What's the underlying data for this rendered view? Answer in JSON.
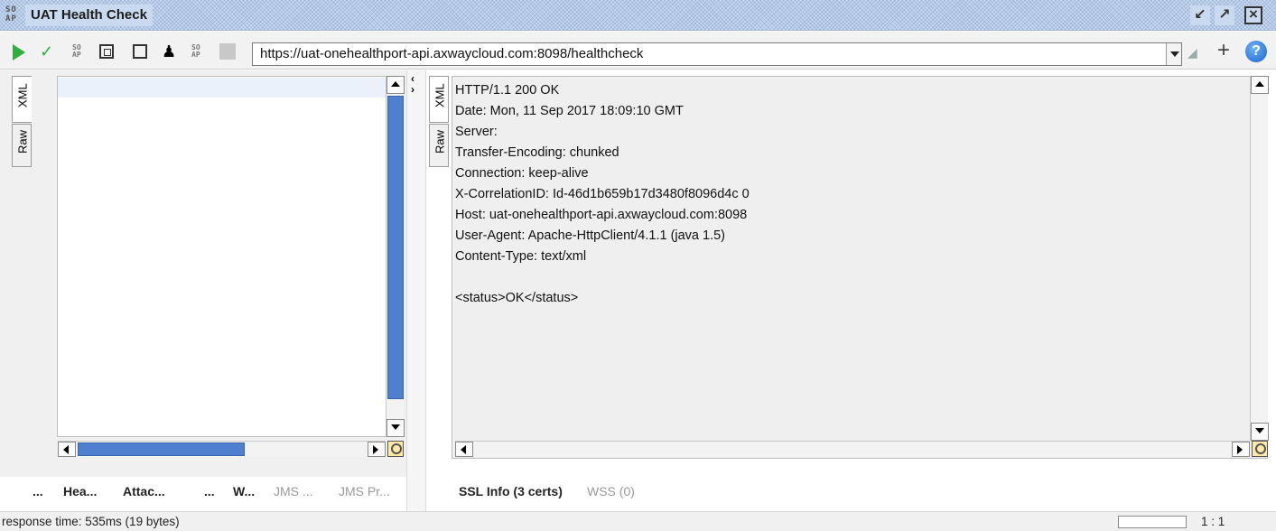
{
  "window": {
    "title": "UAT Health Check",
    "title_icon": "SO\nAP"
  },
  "toolbar": {
    "url": "https://uat-onehealthport-api.axwaycloud.com:8098/healthcheck",
    "plus_glyph": "+",
    "help_glyph": "?"
  },
  "request_panel": {
    "vertical_tabs": [
      "XML",
      "Raw"
    ],
    "bottom_tabs": [
      "...",
      "Hea...",
      "Attac...",
      "...",
      "W...",
      "JMS ...",
      "JMS Pr..."
    ]
  },
  "response_panel": {
    "vertical_tabs": [
      "XML",
      "Raw"
    ],
    "lines": [
      "HTTP/1.1 200 OK",
      "Date: Mon, 11 Sep 2017 18:09:10 GMT",
      "Server:",
      "Transfer-Encoding: chunked",
      "Connection: keep-alive",
      "X-CorrelationID: Id-46d1b659b17d3480f8096d4c 0",
      "Host: uat-onehealthport-api.axwaycloud.com:8098",
      "User-Agent: Apache-HttpClient/4.1.1 (java 1.5)",
      "Content-Type: text/xml",
      "",
      "<status>OK</status>"
    ],
    "bottom_tabs": [
      "SSL Info (3 certs)",
      "WSS (0)"
    ]
  },
  "statusbar": {
    "response_time": "response time: 535ms (19 bytes)",
    "cursor_position": "1 : 1"
  },
  "colors": {
    "title_bg": "#c9daf0",
    "run_green": "#2fae3d",
    "scroll_thumb": "#4f7fcf",
    "response_bg": "#efefef"
  }
}
